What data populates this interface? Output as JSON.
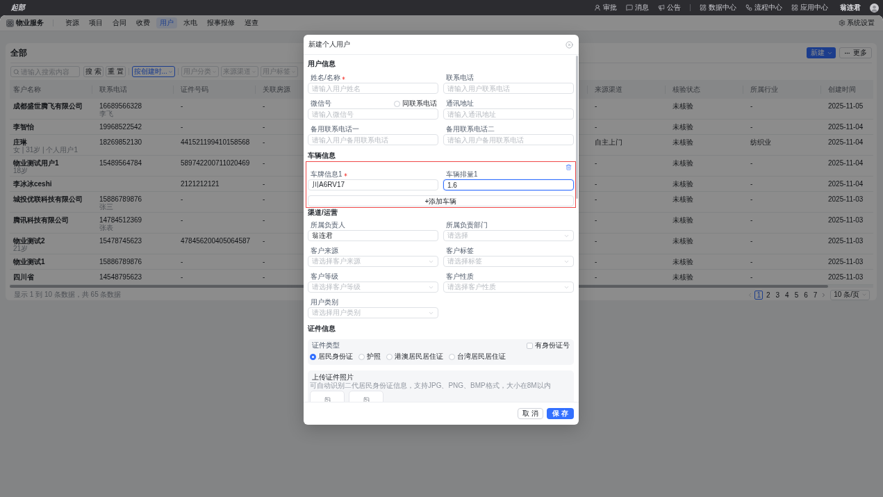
{
  "top_bar": {
    "logo": "起部",
    "links": [
      {
        "label": "审批"
      },
      {
        "label": "消息"
      },
      {
        "label": "公告"
      }
    ],
    "centers": [
      {
        "label": "数据中心"
      },
      {
        "label": "流程中心"
      },
      {
        "label": "应用中心"
      }
    ],
    "user": "翁连君"
  },
  "nav": {
    "brand": "物业服务",
    "items": [
      {
        "label": "资源",
        "selected": false
      },
      {
        "label": "项目",
        "selected": false
      },
      {
        "label": "合同",
        "selected": false
      },
      {
        "label": "收费",
        "selected": false
      },
      {
        "label": "用户",
        "selected": true
      },
      {
        "label": "水电",
        "selected": false
      },
      {
        "label": "报事报修",
        "selected": false
      },
      {
        "label": "巡查",
        "selected": false
      }
    ],
    "settings": "系统设置"
  },
  "page": {
    "title": "全部",
    "new_button": "新建",
    "more_button": "更多"
  },
  "filters": {
    "search": {
      "placeholder": "请输入搜索内容"
    },
    "buttons": [
      "搜 索",
      "重 置"
    ],
    "selects": [
      {
        "value": "按创建时..."
      },
      {
        "placeholder": "用户分类"
      },
      {
        "placeholder": "来源渠道"
      },
      {
        "placeholder": "用户标签"
      }
    ]
  },
  "table": {
    "columns": [
      "客户名称",
      "联系电话",
      "证件号码",
      "关联房源",
      "来源渠道",
      "核验状态",
      "所属行业",
      "创建时间"
    ],
    "rows": [
      {
        "cells": [
          {
            "text": "成都盛世腾飞有限公司"
          },
          {
            "text": "16689566328",
            "note": "李飞"
          },
          {
            "text": "-"
          },
          {
            "text": "-"
          },
          {
            "text": "-"
          },
          {
            "text": "未核验"
          },
          {
            "text": "-"
          },
          {
            "text": "2025-11-05"
          }
        ]
      },
      {
        "cells": [
          {
            "text": "李智怡"
          },
          {
            "text": "19968522542"
          },
          {
            "text": "-"
          },
          {
            "text": "-"
          },
          {
            "text": "-"
          },
          {
            "text": "未核验"
          },
          {
            "text": "-"
          },
          {
            "text": "2025-11-04"
          }
        ]
      },
      {
        "cells": [
          {
            "text": "庄琳",
            "note": "女 | 31岁 | 个人用户1"
          },
          {
            "text": "18269852130"
          },
          {
            "text": "441521199410158568"
          },
          {
            "text": "-"
          },
          {
            "text": "自主上门"
          },
          {
            "text": "未核验"
          },
          {
            "text": "纺织业"
          },
          {
            "text": "2025-11-04"
          }
        ]
      },
      {
        "cells": [
          {
            "text": "物业测试用户1",
            "note": "18岁"
          },
          {
            "text": "15489564784"
          },
          {
            "text": "589742200711020469"
          },
          {
            "text": "-"
          },
          {
            "text": "-"
          },
          {
            "text": "未核验"
          },
          {
            "text": "-"
          },
          {
            "text": "2025-11-04"
          }
        ]
      },
      {
        "cells": [
          {
            "text": "李冰冰ceshi"
          },
          {},
          {
            "text": "2121212121"
          },
          {
            "text": "-"
          },
          {
            "text": "-"
          },
          {
            "text": "未核验"
          },
          {
            "text": "-"
          },
          {
            "text": "2025-11-04"
          }
        ]
      },
      {
        "cells": [
          {
            "text": "城投优联科技有限公司"
          },
          {
            "text": "15886789876",
            "note": "张三"
          },
          {
            "text": "-"
          },
          {
            "text": "-"
          },
          {
            "text": "-"
          },
          {
            "text": "未核验"
          },
          {
            "text": "-"
          },
          {
            "text": "2025-11-03"
          }
        ]
      },
      {
        "cells": [
          {
            "text": "腾讯科技有限公司"
          },
          {
            "text": "14784512369",
            "note": "张表"
          },
          {
            "text": "-"
          },
          {
            "text": "-"
          },
          {
            "text": "-"
          },
          {
            "text": "未核验"
          },
          {
            "text": "-"
          },
          {
            "text": "2025-11-03"
          }
        ]
      },
      {
        "cells": [
          {
            "text": "物业测试2",
            "note": "21岁"
          },
          {
            "text": "15478745623"
          },
          {
            "text": "478456200405064587"
          },
          {
            "text": "-"
          },
          {
            "text": "-"
          },
          {
            "text": "未核验"
          },
          {
            "text": "-"
          },
          {
            "text": "2025-11-03"
          }
        ]
      },
      {
        "cells": [
          {
            "text": "物业测试1"
          },
          {
            "text": "15886789876"
          },
          {
            "text": "-"
          },
          {
            "text": "-"
          },
          {
            "text": "-"
          },
          {
            "text": "未核验"
          },
          {
            "text": "-"
          },
          {
            "text": "2025-11-03"
          }
        ]
      },
      {
        "cells": [
          {
            "text": "四川省"
          },
          {
            "text": "14548795623"
          },
          {
            "text": "-"
          },
          {
            "text": "-"
          },
          {
            "text": "-"
          },
          {
            "text": "未核验"
          },
          {
            "text": "-"
          },
          {
            "text": "2025-11-03"
          }
        ]
      }
    ]
  },
  "summary": "显示 1 到 10 条数据，共 65 条数据",
  "pagination": {
    "pages": [
      {
        "label": "1",
        "selected": true
      },
      {
        "label": "2",
        "selected": false
      },
      {
        "label": "3",
        "selected": false
      },
      {
        "label": "4",
        "selected": false
      },
      {
        "label": "5",
        "selected": false
      },
      {
        "label": "6",
        "selected": false
      },
      {
        "label": "7",
        "selected": false
      }
    ],
    "page_size": "10 条/页"
  },
  "dialog": {
    "title": "新建个人用户",
    "user_info": {
      "title": "用户信息",
      "fields": [
        {
          "label": "姓名/名称",
          "required": true,
          "placeholder": "请输入用户姓名"
        },
        {
          "label": "联系电话",
          "required": false,
          "placeholder": "请输入用户联系电话"
        },
        {
          "label": "微信号",
          "required": false,
          "placeholder": "请输入微信号",
          "option": {
            "label": "同联系电话",
            "checked": false
          }
        },
        {
          "label": "通讯地址",
          "required": false,
          "placeholder": "请输入通讯地址"
        },
        {
          "label": "备用联系电话一",
          "required": false,
          "placeholder": "请输入用户备用联系电话"
        },
        {
          "label": "备用联系电话二",
          "required": false,
          "placeholder": "请输入用户备用联系电话"
        }
      ]
    },
    "vehicle_info": {
      "title": "车辆信息",
      "vehicles": [
        {
          "fields": [
            {
              "label": "车牌信息1",
              "required": true,
              "value": "川A6RV17",
              "focused": false
            },
            {
              "label": "车辆排量1",
              "required": false,
              "value": "1.6",
              "focused": true
            }
          ]
        }
      ],
      "add_button": "+添加车辆"
    },
    "channel_info": {
      "title": "渠道/运营",
      "fields": [
        {
          "kind": "input",
          "label": "所属负责人",
          "value": "翁连君"
        },
        {
          "kind": "select",
          "label": "所属负责部门",
          "placeholder": "请选择"
        },
        {
          "kind": "select",
          "label": "客户来源",
          "placeholder": "请选择客户来源"
        },
        {
          "kind": "select",
          "label": "客户标签",
          "placeholder": "请选择标签"
        },
        {
          "kind": "select",
          "label": "客户等级",
          "placeholder": "请选择客户等级"
        },
        {
          "kind": "select",
          "label": "客户性质",
          "placeholder": "请选择客户性质"
        },
        {
          "kind": "select",
          "label": "用户类别",
          "placeholder": "请选择用户类别"
        }
      ]
    },
    "id_info": {
      "title": "证件信息",
      "type_label": "证件类型",
      "has_id": {
        "label": "有身份证号",
        "checked": false
      },
      "types": [
        {
          "label": "居民身份证",
          "selected": true
        },
        {
          "label": "护照",
          "selected": false
        },
        {
          "label": "港澳居民居住证",
          "selected": false
        },
        {
          "label": "台湾居民居住证",
          "selected": false
        }
      ],
      "upload": {
        "title": "上传证件照片",
        "hint": "可自动识别二代居民身份证信息，支持JPG、PNG、BMP格式，大小在8M以内",
        "slots": [
          {
            "kind": "image"
          },
          {
            "kind": "image"
          }
        ]
      }
    },
    "buttons": {
      "cancel": "取 消",
      "save": "保 存"
    }
  }
}
